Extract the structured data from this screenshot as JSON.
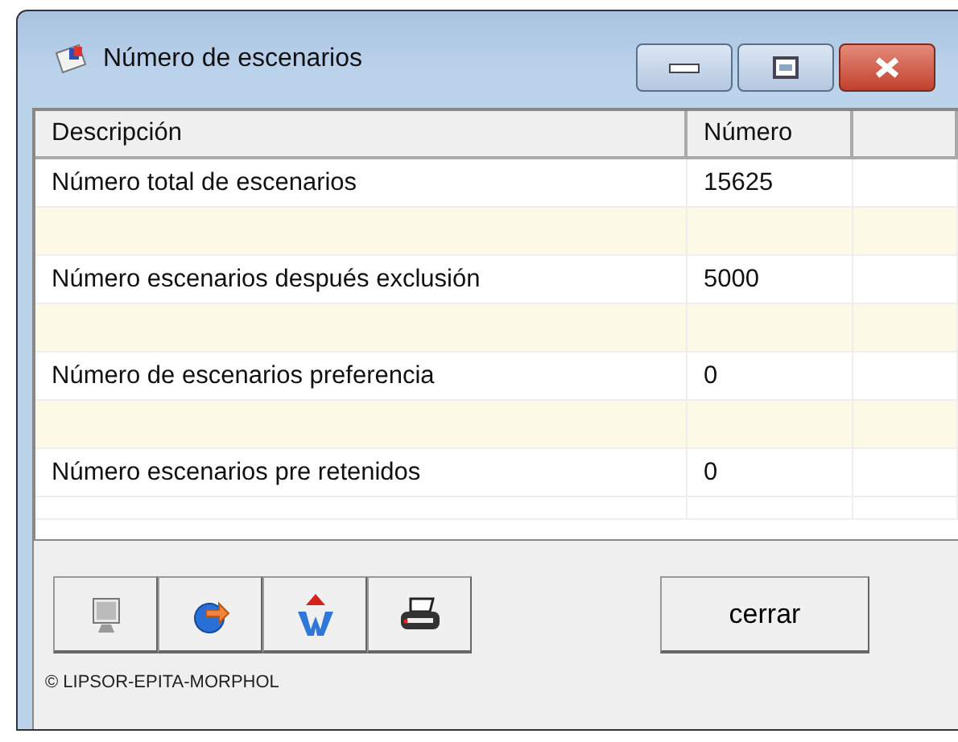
{
  "window": {
    "title": "Número de escenarios"
  },
  "table": {
    "columns": [
      "Descripción",
      "Número"
    ],
    "rows": [
      {
        "kind": "data",
        "description": "Número total de escenarios",
        "value": "15625"
      },
      {
        "kind": "blank"
      },
      {
        "kind": "data",
        "description": "Número escenarios después exclusión",
        "value": "5000"
      },
      {
        "kind": "blank"
      },
      {
        "kind": "data",
        "description": "Número de escenarios preferencia",
        "value": "0"
      },
      {
        "kind": "blank"
      },
      {
        "kind": "data",
        "description": "Número escenarios pre retenidos",
        "value": "0"
      },
      {
        "kind": "end"
      }
    ]
  },
  "toolbar": [
    {
      "kind": "monitor"
    },
    {
      "kind": "export"
    },
    {
      "kind": "word"
    },
    {
      "kind": "print"
    }
  ],
  "close_button": "cerrar",
  "copyright": "© LIPSOR-EPITA-MORPHOL"
}
